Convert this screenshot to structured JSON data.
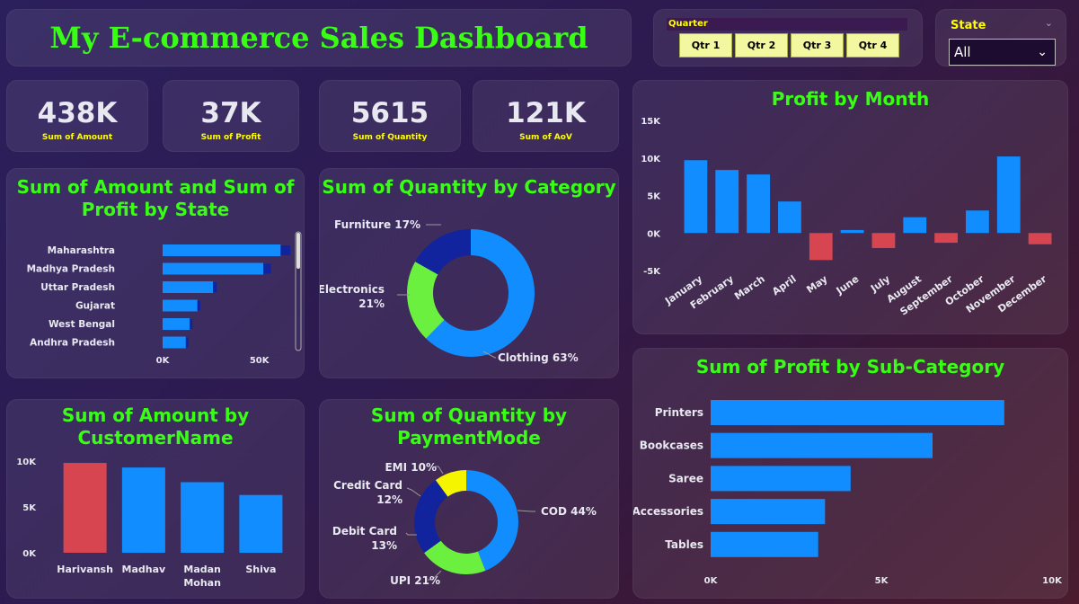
{
  "header": {
    "title": "My E-commerce Sales Dashboard"
  },
  "quarter_slicer": {
    "label": "Quarter",
    "options": [
      "Qtr 1",
      "Qtr 2",
      "Qtr 3",
      "Qtr 4"
    ]
  },
  "state_slicer": {
    "label": "State",
    "selected": "All"
  },
  "kpis": [
    {
      "value": "438K",
      "label": "Sum of Amount"
    },
    {
      "value": "37K",
      "label": "Sum of Profit"
    },
    {
      "value": "5615",
      "label": "Sum of Quantity"
    },
    {
      "value": "121K",
      "label": "Sum of AoV"
    }
  ],
  "titles": {
    "state": "Sum of Amount and Sum of Profit by State",
    "category": "Sum of Quantity by Category",
    "month": "Profit by Month",
    "customer": "Sum of Amount by CustomerName",
    "payment": "Sum of Quantity by PaymentMode",
    "subcat": "Sum of Profit by Sub-Category"
  },
  "colors": {
    "blue": "#118dff",
    "red": "#d64550",
    "navy": "#12239e",
    "green": "#6cf040",
    "yellow": "#f5f500",
    "title_green": "#39ff14",
    "kpi_label": "#ffff00"
  },
  "chart_data": [
    {
      "id": "state",
      "type": "bar",
      "orientation": "horizontal",
      "categories": [
        "Maharashtra",
        "Madhya Pradesh",
        "Uttar Pradesh",
        "Gujarat",
        "West Bengal",
        "Andhra Pradesh"
      ],
      "series": [
        {
          "name": "Sum of Amount",
          "values": [
            61000,
            52000,
            26000,
            18000,
            14000,
            12000
          ]
        },
        {
          "name": "Sum of Profit",
          "values": [
            5000,
            4000,
            2000,
            1500,
            1000,
            800
          ]
        }
      ],
      "xticks": [
        "0K",
        "50K"
      ],
      "xlim": [
        0,
        65000
      ]
    },
    {
      "id": "category",
      "type": "pie",
      "donut": true,
      "slices": [
        {
          "label": "Clothing",
          "value": 63,
          "text": "Clothing 63%"
        },
        {
          "label": "Electronics",
          "value": 21,
          "text": "Electronics 21%"
        },
        {
          "label": "Furniture",
          "value": 17,
          "text": "Furniture 17%"
        }
      ]
    },
    {
      "id": "month",
      "type": "bar",
      "categories": [
        "January",
        "February",
        "March",
        "April",
        "May",
        "June",
        "July",
        "August",
        "September",
        "October",
        "November",
        "December"
      ],
      "values": [
        9700,
        8400,
        7800,
        4200,
        -3600,
        400,
        -2000,
        2100,
        -1300,
        3000,
        10200,
        -1500
      ],
      "yticks": [
        "15K",
        "10K",
        "5K",
        "0K",
        "-5K"
      ],
      "ylim": [
        -5000,
        15000
      ]
    },
    {
      "id": "customer",
      "type": "bar",
      "categories": [
        "Harivansh",
        "Madhav",
        "Madan Mohan",
        "Shiva"
      ],
      "values": [
        9800,
        9300,
        7700,
        6300
      ],
      "yticks": [
        "10K",
        "5K",
        "0K"
      ],
      "ylim": [
        0,
        10000
      ]
    },
    {
      "id": "payment",
      "type": "pie",
      "donut": true,
      "slices": [
        {
          "label": "COD",
          "value": 44,
          "text": "COD 44%"
        },
        {
          "label": "UPI",
          "value": 21,
          "text": "UPI 21%"
        },
        {
          "label": "Debit Card",
          "value": 13,
          "text": "Debit Card 13%"
        },
        {
          "label": "Credit Card",
          "value": 12,
          "text": "Credit Card 12%"
        },
        {
          "label": "EMI",
          "value": 10,
          "text": "EMI 10%"
        }
      ]
    },
    {
      "id": "subcat",
      "type": "bar",
      "orientation": "horizontal",
      "categories": [
        "Printers",
        "Bookcases",
        "Saree",
        "Accessories",
        "Tables"
      ],
      "values": [
        8600,
        6500,
        4100,
        3350,
        3150
      ],
      "xticks": [
        "0K",
        "5K",
        "10K"
      ],
      "xlim": [
        0,
        10000
      ]
    }
  ]
}
